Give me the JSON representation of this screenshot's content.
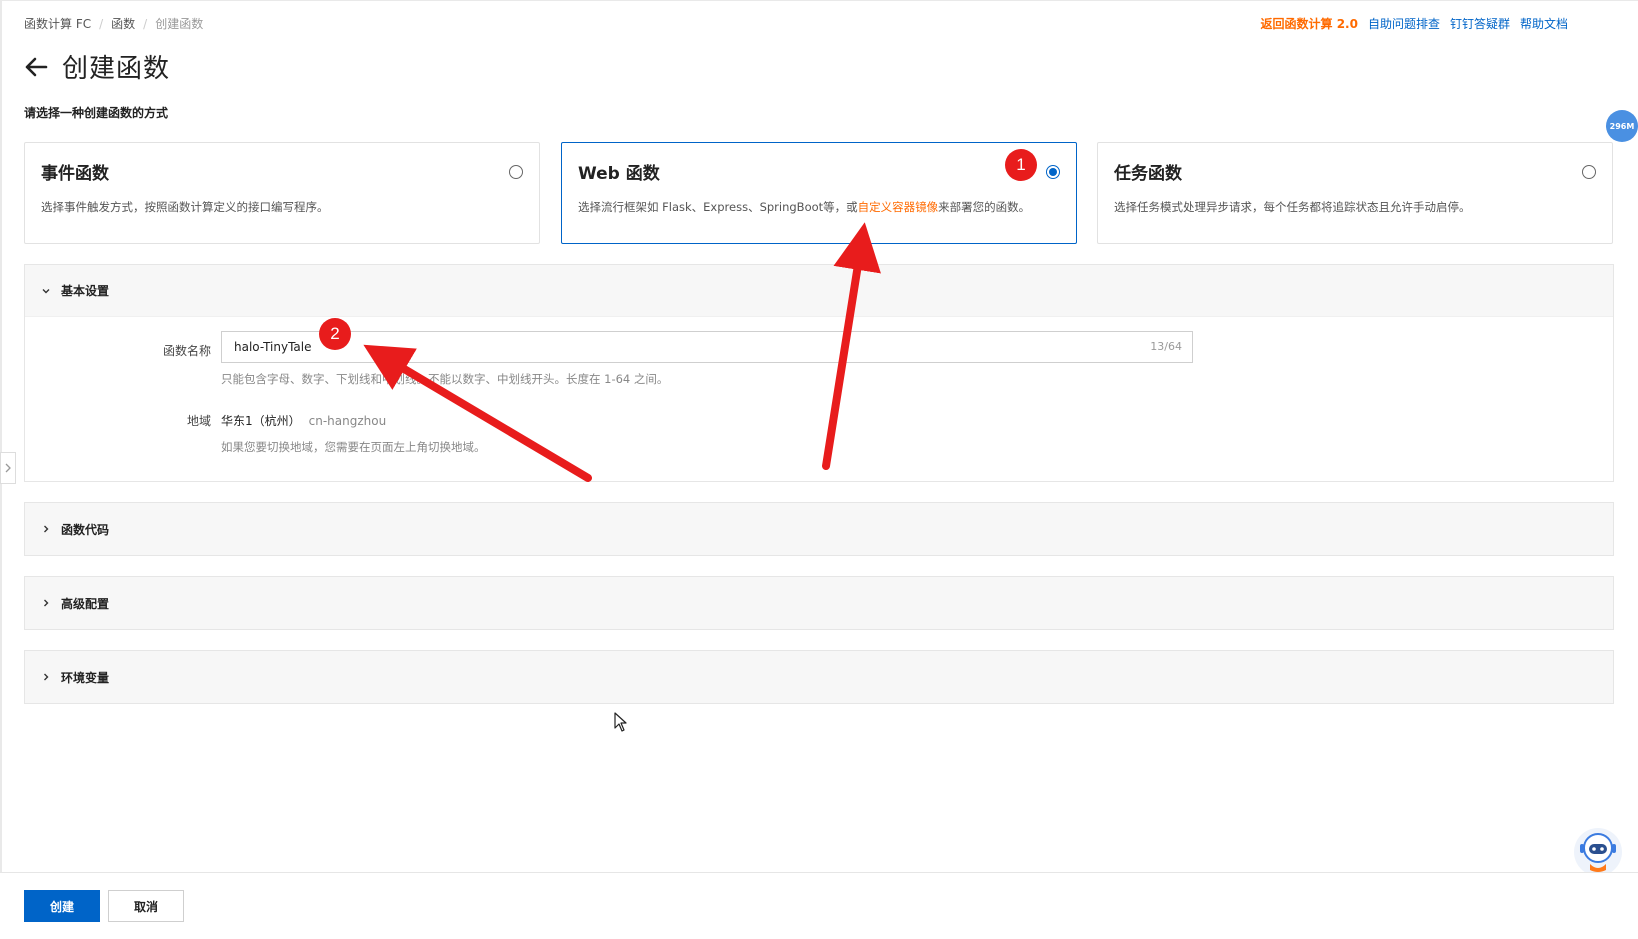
{
  "breadcrumb": {
    "items": [
      "函数计算 FC",
      "函数",
      "创建函数"
    ]
  },
  "top_links": {
    "back_v2": "返回函数计算 2.0",
    "self_help": "自助问题排查",
    "dingtalk": "钉钉答疑群",
    "help_docs": "帮助文档"
  },
  "page": {
    "title": "创建函数",
    "choose_label": "请选择一种创建函数的方式",
    "memory_badge": "296M"
  },
  "cards": {
    "event": {
      "title": "事件函数",
      "desc": "选择事件触发方式，按照函数计算定义的接口编写程序。",
      "selected": false
    },
    "web": {
      "title": "Web 函数",
      "desc_before": "选择流行框架如 Flask、Express、SpringBoot等，或",
      "desc_link": "自定义容器镜像",
      "desc_after": "来部署您的函数。",
      "selected": true
    },
    "task": {
      "title": "任务函数",
      "desc": "选择任务模式处理异步请求，每个任务都将追踪状态且允许手动启停。",
      "selected": false
    }
  },
  "annotations": {
    "badge1": "1",
    "badge2": "2"
  },
  "basic_settings": {
    "title": "基本设置",
    "function_name_label": "函数名称",
    "function_name_value": "halo-TinyTale",
    "function_name_counter": "13/64",
    "function_name_help": "只能包含字母、数字、下划线和中划线。不能以数字、中划线开头。长度在 1-64 之间。",
    "region_label": "地域",
    "region_value": "华东1（杭州）",
    "region_code": "cn-hangzhou",
    "region_help": "如果您要切换地域，您需要在页面左上角切换地域。"
  },
  "sections": {
    "code": "函数代码",
    "advanced": "高级配置",
    "env": "环境变量"
  },
  "footer": {
    "create": "创建",
    "cancel": "取消"
  },
  "colors": {
    "primary": "#0064c8",
    "accent_orange": "#ff6a00",
    "annotation_red": "#e81c1c"
  }
}
